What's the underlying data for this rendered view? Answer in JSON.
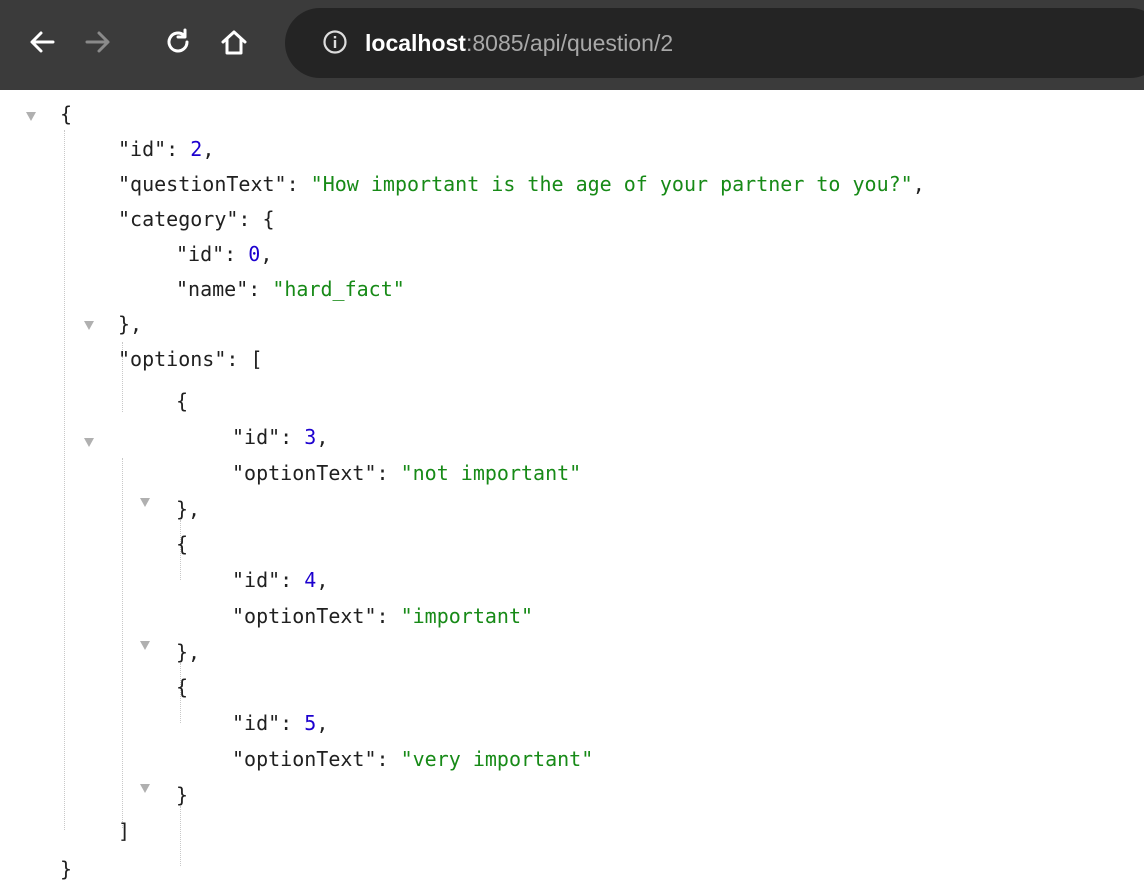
{
  "browser": {
    "url_host": "localhost",
    "url_path": ":8085/api/question/2"
  },
  "json": {
    "open_brace": "{",
    "id_key": "\"id\"",
    "id_value": "2",
    "questionText_key": "\"questionText\"",
    "questionText_value": "\"How important is the age of your partner to you?\"",
    "category_key": "\"category\"",
    "category_id_key": "\"id\"",
    "category_id_value": "0",
    "category_name_key": "\"name\"",
    "category_name_value": "\"hard_fact\"",
    "options_key": "\"options\"",
    "options": [
      {
        "id_key": "\"id\"",
        "id_value": "3",
        "text_key": "\"optionText\"",
        "text_value": "\"not important\""
      },
      {
        "id_key": "\"id\"",
        "id_value": "4",
        "text_key": "\"optionText\"",
        "text_value": "\"important\""
      },
      {
        "id_key": "\"id\"",
        "id_value": "5",
        "text_key": "\"optionText\"",
        "text_value": "\"very important\""
      }
    ],
    "close_bracket": "]",
    "close_brace": "}"
  }
}
